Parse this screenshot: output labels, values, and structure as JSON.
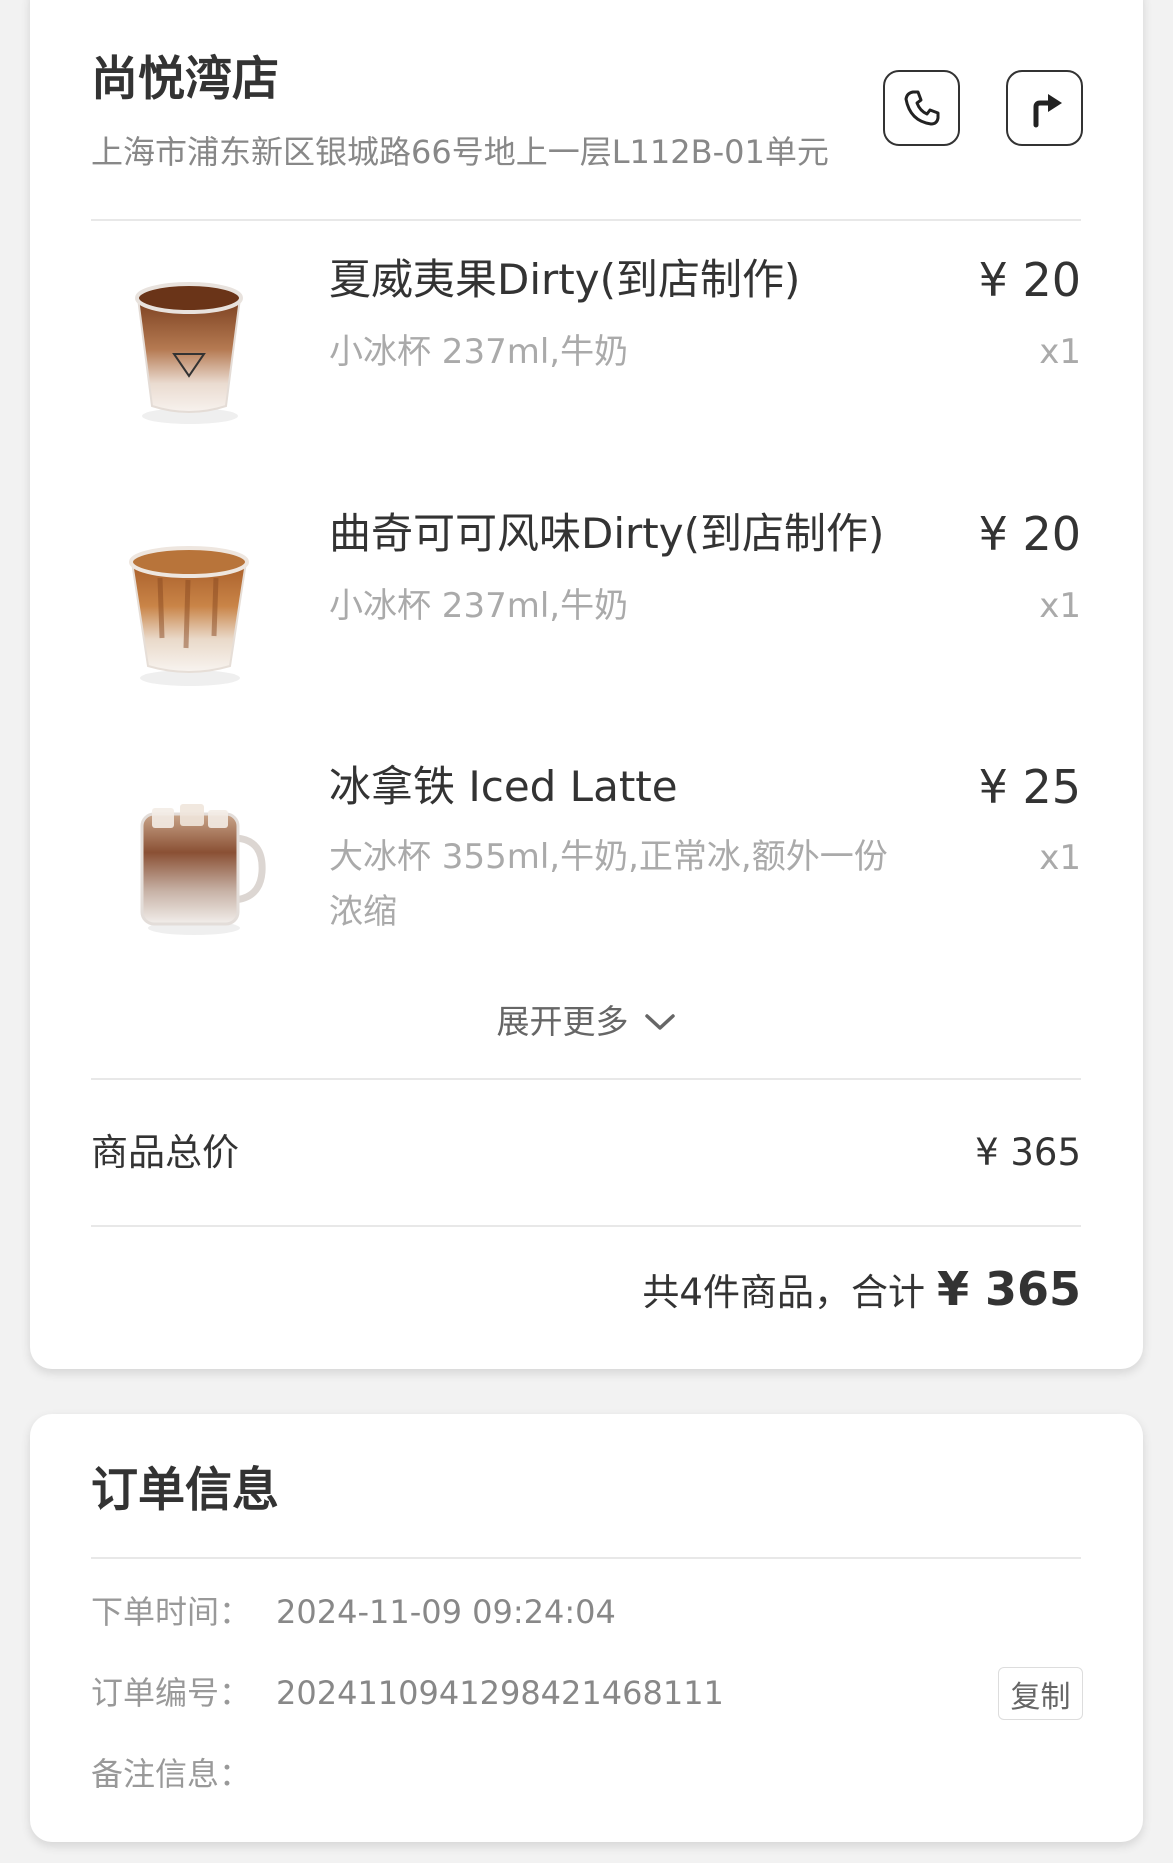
{
  "store": {
    "name": "尚悦湾店",
    "address": "上海市浦东新区银城路66号地上一层L112B-01单元"
  },
  "icons": {
    "phone": "phone-icon",
    "directions": "directions-icon",
    "expand": "chevron-down-icon"
  },
  "items": [
    {
      "title": "夏威夷果Dirty(到店制作)",
      "price": "¥ 20",
      "options": "小冰杯 237ml,牛奶",
      "qty": "x1"
    },
    {
      "title": "曲奇可可风味Dirty(到店制作)",
      "price": "¥ 20",
      "options": "小冰杯 237ml,牛奶",
      "qty": "x1"
    },
    {
      "title": "冰拿铁 Iced Latte",
      "price": "¥ 25",
      "options": "大冰杯 355ml,牛奶,正常冰,额外一份浓缩",
      "qty": "x1"
    }
  ],
  "expand_label": "展开更多",
  "subtotal": {
    "label": "商品总价",
    "value": "¥ 365"
  },
  "total": {
    "prefix": "共4件商品，合计",
    "value": "¥ 365"
  },
  "order_info": {
    "title": "订单信息",
    "rows": [
      {
        "label": "下单时间：",
        "value": "2024-11-09 09:24:04"
      },
      {
        "label": "订单编号：",
        "value": "2024110941298421468111"
      },
      {
        "label": "备注信息：",
        "value": ""
      }
    ],
    "copy_label": "复制"
  },
  "colors": {
    "text_primary": "#333333",
    "text_secondary": "#888888",
    "text_muted": "#aaaaaa",
    "background": "#f2f2f2",
    "card": "#ffffff"
  }
}
